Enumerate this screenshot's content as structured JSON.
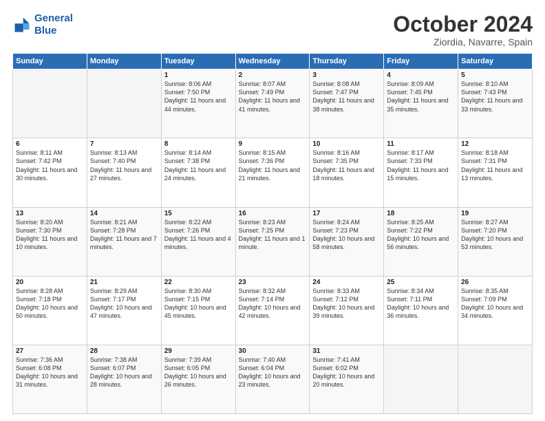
{
  "header": {
    "logo_line1": "General",
    "logo_line2": "Blue",
    "title": "October 2024",
    "subtitle": "Ziordia, Navarre, Spain"
  },
  "days_of_week": [
    "Sunday",
    "Monday",
    "Tuesday",
    "Wednesday",
    "Thursday",
    "Friday",
    "Saturday"
  ],
  "weeks": [
    [
      {
        "day": "",
        "sunrise": "",
        "sunset": "",
        "daylight": ""
      },
      {
        "day": "",
        "sunrise": "",
        "sunset": "",
        "daylight": ""
      },
      {
        "day": "1",
        "sunrise": "Sunrise: 8:06 AM",
        "sunset": "Sunset: 7:50 PM",
        "daylight": "Daylight: 11 hours and 44 minutes."
      },
      {
        "day": "2",
        "sunrise": "Sunrise: 8:07 AM",
        "sunset": "Sunset: 7:49 PM",
        "daylight": "Daylight: 11 hours and 41 minutes."
      },
      {
        "day": "3",
        "sunrise": "Sunrise: 8:08 AM",
        "sunset": "Sunset: 7:47 PM",
        "daylight": "Daylight: 11 hours and 38 minutes."
      },
      {
        "day": "4",
        "sunrise": "Sunrise: 8:09 AM",
        "sunset": "Sunset: 7:45 PM",
        "daylight": "Daylight: 11 hours and 35 minutes."
      },
      {
        "day": "5",
        "sunrise": "Sunrise: 8:10 AM",
        "sunset": "Sunset: 7:43 PM",
        "daylight": "Daylight: 11 hours and 33 minutes."
      }
    ],
    [
      {
        "day": "6",
        "sunrise": "Sunrise: 8:11 AM",
        "sunset": "Sunset: 7:42 PM",
        "daylight": "Daylight: 11 hours and 30 minutes."
      },
      {
        "day": "7",
        "sunrise": "Sunrise: 8:13 AM",
        "sunset": "Sunset: 7:40 PM",
        "daylight": "Daylight: 11 hours and 27 minutes."
      },
      {
        "day": "8",
        "sunrise": "Sunrise: 8:14 AM",
        "sunset": "Sunset: 7:38 PM",
        "daylight": "Daylight: 11 hours and 24 minutes."
      },
      {
        "day": "9",
        "sunrise": "Sunrise: 8:15 AM",
        "sunset": "Sunset: 7:36 PM",
        "daylight": "Daylight: 11 hours and 21 minutes."
      },
      {
        "day": "10",
        "sunrise": "Sunrise: 8:16 AM",
        "sunset": "Sunset: 7:35 PM",
        "daylight": "Daylight: 11 hours and 18 minutes."
      },
      {
        "day": "11",
        "sunrise": "Sunrise: 8:17 AM",
        "sunset": "Sunset: 7:33 PM",
        "daylight": "Daylight: 11 hours and 15 minutes."
      },
      {
        "day": "12",
        "sunrise": "Sunrise: 8:18 AM",
        "sunset": "Sunset: 7:31 PM",
        "daylight": "Daylight: 11 hours and 13 minutes."
      }
    ],
    [
      {
        "day": "13",
        "sunrise": "Sunrise: 8:20 AM",
        "sunset": "Sunset: 7:30 PM",
        "daylight": "Daylight: 11 hours and 10 minutes."
      },
      {
        "day": "14",
        "sunrise": "Sunrise: 8:21 AM",
        "sunset": "Sunset: 7:28 PM",
        "daylight": "Daylight: 11 hours and 7 minutes."
      },
      {
        "day": "15",
        "sunrise": "Sunrise: 8:22 AM",
        "sunset": "Sunset: 7:26 PM",
        "daylight": "Daylight: 11 hours and 4 minutes."
      },
      {
        "day": "16",
        "sunrise": "Sunrise: 8:23 AM",
        "sunset": "Sunset: 7:25 PM",
        "daylight": "Daylight: 11 hours and 1 minute."
      },
      {
        "day": "17",
        "sunrise": "Sunrise: 8:24 AM",
        "sunset": "Sunset: 7:23 PM",
        "daylight": "Daylight: 10 hours and 58 minutes."
      },
      {
        "day": "18",
        "sunrise": "Sunrise: 8:25 AM",
        "sunset": "Sunset: 7:22 PM",
        "daylight": "Daylight: 10 hours and 56 minutes."
      },
      {
        "day": "19",
        "sunrise": "Sunrise: 8:27 AM",
        "sunset": "Sunset: 7:20 PM",
        "daylight": "Daylight: 10 hours and 53 minutes."
      }
    ],
    [
      {
        "day": "20",
        "sunrise": "Sunrise: 8:28 AM",
        "sunset": "Sunset: 7:18 PM",
        "daylight": "Daylight: 10 hours and 50 minutes."
      },
      {
        "day": "21",
        "sunrise": "Sunrise: 8:29 AM",
        "sunset": "Sunset: 7:17 PM",
        "daylight": "Daylight: 10 hours and 47 minutes."
      },
      {
        "day": "22",
        "sunrise": "Sunrise: 8:30 AM",
        "sunset": "Sunset: 7:15 PM",
        "daylight": "Daylight: 10 hours and 45 minutes."
      },
      {
        "day": "23",
        "sunrise": "Sunrise: 8:32 AM",
        "sunset": "Sunset: 7:14 PM",
        "daylight": "Daylight: 10 hours and 42 minutes."
      },
      {
        "day": "24",
        "sunrise": "Sunrise: 8:33 AM",
        "sunset": "Sunset: 7:12 PM",
        "daylight": "Daylight: 10 hours and 39 minutes."
      },
      {
        "day": "25",
        "sunrise": "Sunrise: 8:34 AM",
        "sunset": "Sunset: 7:11 PM",
        "daylight": "Daylight: 10 hours and 36 minutes."
      },
      {
        "day": "26",
        "sunrise": "Sunrise: 8:35 AM",
        "sunset": "Sunset: 7:09 PM",
        "daylight": "Daylight: 10 hours and 34 minutes."
      }
    ],
    [
      {
        "day": "27",
        "sunrise": "Sunrise: 7:36 AM",
        "sunset": "Sunset: 6:08 PM",
        "daylight": "Daylight: 10 hours and 31 minutes."
      },
      {
        "day": "28",
        "sunrise": "Sunrise: 7:38 AM",
        "sunset": "Sunset: 6:07 PM",
        "daylight": "Daylight: 10 hours and 28 minutes."
      },
      {
        "day": "29",
        "sunrise": "Sunrise: 7:39 AM",
        "sunset": "Sunset: 6:05 PM",
        "daylight": "Daylight: 10 hours and 26 minutes."
      },
      {
        "day": "30",
        "sunrise": "Sunrise: 7:40 AM",
        "sunset": "Sunset: 6:04 PM",
        "daylight": "Daylight: 10 hours and 23 minutes."
      },
      {
        "day": "31",
        "sunrise": "Sunrise: 7:41 AM",
        "sunset": "Sunset: 6:02 PM",
        "daylight": "Daylight: 10 hours and 20 minutes."
      },
      {
        "day": "",
        "sunrise": "",
        "sunset": "",
        "daylight": ""
      },
      {
        "day": "",
        "sunrise": "",
        "sunset": "",
        "daylight": ""
      }
    ]
  ]
}
